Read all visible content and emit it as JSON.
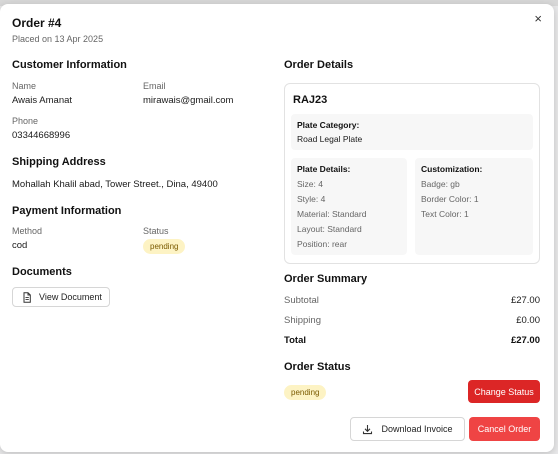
{
  "header": {
    "title": "Order #4",
    "placed_on": "Placed on 13 Apr 2025",
    "close_glyph": "×"
  },
  "customer": {
    "heading": "Customer Information",
    "name_label": "Name",
    "name_value": "Awais Amanat",
    "email_label": "Email",
    "email_value": "mirawais@gmail.com",
    "phone_label": "Phone",
    "phone_value": "03344668996"
  },
  "shipping": {
    "heading": "Shipping Address",
    "address": "Mohallah Khalil abad, Tower Street., Dina, 49400"
  },
  "payment": {
    "heading": "Payment Information",
    "method_label": "Method",
    "method_value": "cod",
    "status_label": "Status",
    "status_value": "pending"
  },
  "documents": {
    "heading": "Documents",
    "view_button": "View Document",
    "view_icon": "file-icon"
  },
  "order_details": {
    "heading": "Order Details",
    "plate_number": "RAJ23",
    "category_title": "Plate Category:",
    "category_value": "Road Legal Plate",
    "details_title": "Plate Details:",
    "details": [
      "Size: 4",
      "Style: 4",
      "Material: Standard",
      "Layout: Standard",
      "Position: rear"
    ],
    "custom_title": "Customization:",
    "customization": [
      "Badge: gb",
      "Border Color: 1",
      "Text Color: 1"
    ]
  },
  "summary": {
    "heading": "Order Summary",
    "subtotal_label": "Subtotal",
    "subtotal_value": "£27.00",
    "shipping_label": "Shipping",
    "shipping_value": "£0.00",
    "total_label": "Total",
    "total_value": "£27.00"
  },
  "status": {
    "heading": "Order Status",
    "value": "pending",
    "change_button": "Change Status"
  },
  "footer": {
    "download_button": "Download Invoice",
    "download_icon": "download-icon",
    "cancel_button": "Cancel Order"
  },
  "colors": {
    "danger": "#dc2626",
    "badge_bg": "#fdf3c4",
    "badge_text": "#7a5a00"
  }
}
